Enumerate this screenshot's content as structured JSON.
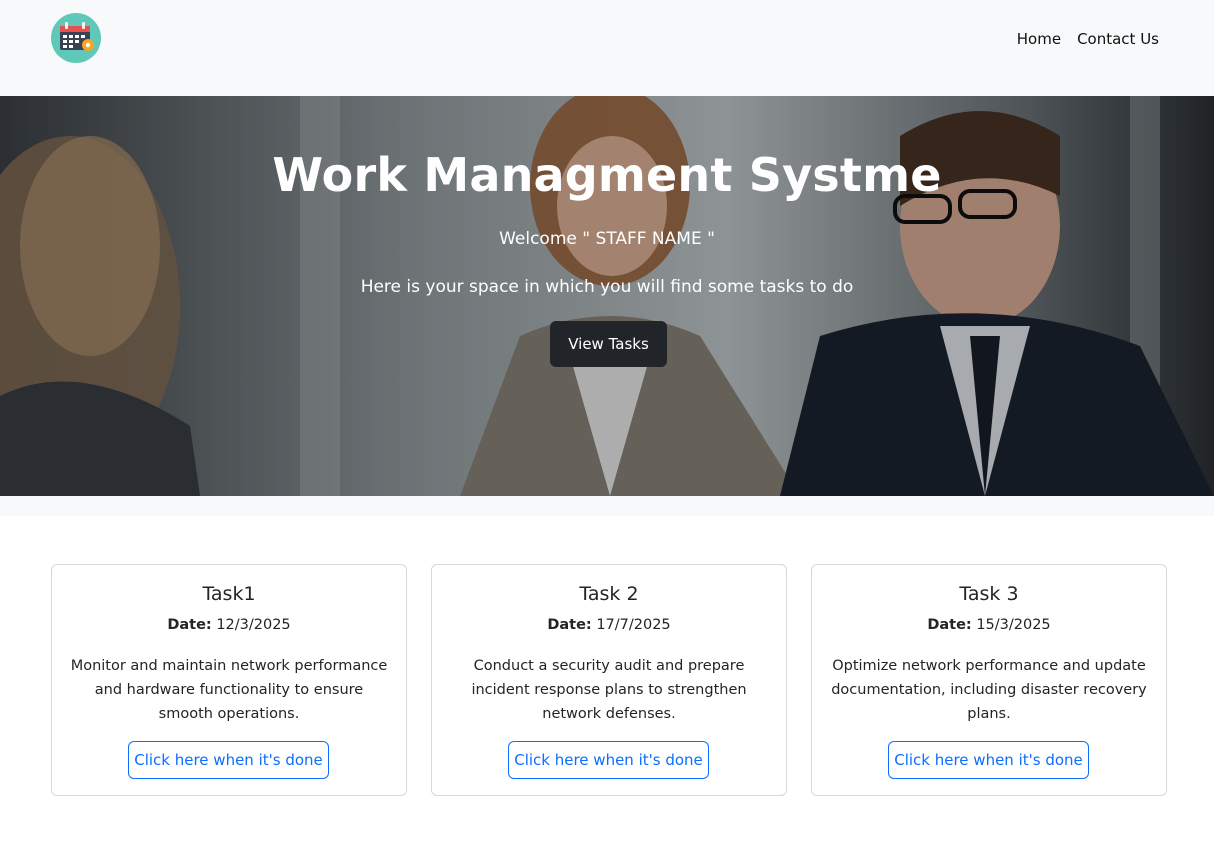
{
  "navbar": {
    "logo_icon": "calendar-gear-icon",
    "links": [
      "Home",
      "Contact Us"
    ]
  },
  "hero": {
    "title": "Work Managment Systme",
    "welcome": "Welcome \" STAFF NAME \"",
    "description": "Here is your space in which you will find some tasks to do",
    "button_label": "View Tasks"
  },
  "tasks": [
    {
      "title": "Task1",
      "date_label": "Date:",
      "date": "12/3/2025",
      "description": "Monitor and maintain network performance and hardware functionality to ensure smooth operations.",
      "button_label": "Click here when it's done"
    },
    {
      "title": "Task 2",
      "date_label": "Date:",
      "date": "17/7/2025",
      "description": "Conduct a security audit and prepare incident response plans to strengthen network defenses.",
      "button_label": "Click here when it's done"
    },
    {
      "title": "Task 3",
      "date_label": "Date:",
      "date": "15/3/2025",
      "description": "Optimize network performance and update documentation, including disaster recovery plans.",
      "button_label": "Click here when it's done"
    }
  ],
  "colors": {
    "navbar_bg": "#f8f9fa",
    "dark_button": "#212529",
    "primary_blue": "#0d6efd",
    "logo_teal": "#5fc8b8"
  }
}
